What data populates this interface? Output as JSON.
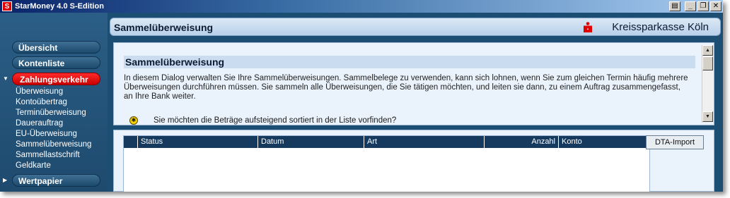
{
  "window": {
    "title": "StarMoney 4.0 S-Edition",
    "app_icon": "S"
  },
  "sidebar": {
    "top_items": [
      "Übersicht",
      "Kontenliste"
    ],
    "active_item": "Zahlungsverkehr",
    "sub_items": [
      "Überweisung",
      "Kontoübertrag",
      "Terminüberweisung",
      "Dauerauftrag",
      "EU-Überweisung",
      "Sammelüberweisung",
      "Sammellastschrift",
      "Geldkarte"
    ],
    "bottom_item": "Wertpapier",
    "active_color": "#e20000"
  },
  "header": {
    "title": "Sammelüberweisung",
    "bank_name": "Kreissparkasse Köln",
    "bank_logo": "sparkasse-logo"
  },
  "info": {
    "heading": "Sammelüberweisung",
    "body": "In diesem Dialog verwalten Sie Ihre Sammelüberweisungen. Sammelbelege zu verwenden, kann sich lohnen, wenn Sie zum gleichen Termin häufig mehrere Überweisungen durchführen müssen. Sie sammeln alle Überweisungen, die Sie tätigen möchten, und leiten sie dann, zu einem Auftrag zusammengefasst, an Ihre Bank weiter.",
    "tip": "Sie möchten die Beträge aufsteigend sortiert in der Liste vorfinden?"
  },
  "table": {
    "columns": [
      "",
      "Status",
      "Datum",
      "Art",
      "Anzahl",
      "Konto"
    ],
    "import_button": "DTA-Import"
  }
}
